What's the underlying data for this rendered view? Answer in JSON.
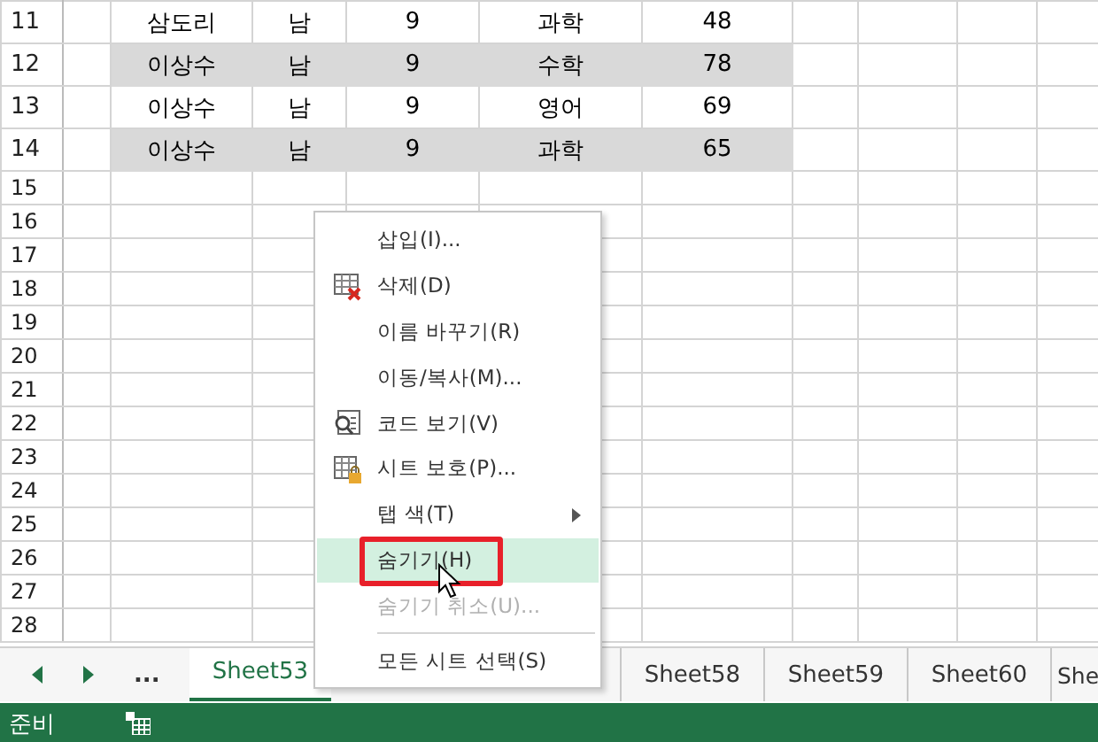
{
  "sheet": {
    "rows": [
      {
        "number": "11",
        "highlighted": false,
        "cells": [
          "삼도리",
          "남",
          "9",
          "과학",
          "48"
        ]
      },
      {
        "number": "12",
        "highlighted": true,
        "cells": [
          "이상수",
          "남",
          "9",
          "수학",
          "78"
        ]
      },
      {
        "number": "13",
        "highlighted": false,
        "cells": [
          "이상수",
          "남",
          "9",
          "영어",
          "69"
        ]
      },
      {
        "number": "14",
        "highlighted": true,
        "cells": [
          "이상수",
          "남",
          "9",
          "과학",
          "65"
        ]
      },
      {
        "number": "15",
        "highlighted": false,
        "cells": []
      },
      {
        "number": "16",
        "highlighted": false,
        "cells": []
      },
      {
        "number": "17",
        "highlighted": false,
        "cells": []
      },
      {
        "number": "18",
        "highlighted": false,
        "cells": []
      },
      {
        "number": "19",
        "highlighted": false,
        "cells": []
      },
      {
        "number": "20",
        "highlighted": false,
        "cells": []
      },
      {
        "number": "21",
        "highlighted": false,
        "cells": []
      },
      {
        "number": "22",
        "highlighted": false,
        "cells": []
      },
      {
        "number": "23",
        "highlighted": false,
        "cells": []
      },
      {
        "number": "24",
        "highlighted": false,
        "cells": []
      },
      {
        "number": "25",
        "highlighted": false,
        "cells": []
      },
      {
        "number": "26",
        "highlighted": false,
        "cells": []
      },
      {
        "number": "27",
        "highlighted": false,
        "cells": []
      },
      {
        "number": "28",
        "highlighted": false,
        "cells": []
      }
    ]
  },
  "context_menu": {
    "items": [
      {
        "label": "삽입(I)...",
        "kind": "plain",
        "disabled": false,
        "selected": false,
        "submenu": false,
        "outlined": false,
        "separator_before": false
      },
      {
        "label": "삭제(D)",
        "kind": "delete",
        "disabled": false,
        "selected": false,
        "submenu": false,
        "outlined": false,
        "separator_before": false
      },
      {
        "label": "이름 바꾸기(R)",
        "kind": "plain",
        "disabled": false,
        "selected": false,
        "submenu": false,
        "outlined": false,
        "separator_before": false
      },
      {
        "label": "이동/복사(M)...",
        "kind": "plain",
        "disabled": false,
        "selected": false,
        "submenu": false,
        "outlined": false,
        "separator_before": false
      },
      {
        "label": "코드 보기(V)",
        "kind": "code",
        "disabled": false,
        "selected": false,
        "submenu": false,
        "outlined": false,
        "separator_before": false
      },
      {
        "label": "시트 보호(P)...",
        "kind": "protect",
        "disabled": false,
        "selected": false,
        "submenu": false,
        "outlined": false,
        "separator_before": false
      },
      {
        "label": "탭 색(T)",
        "kind": "plain",
        "disabled": false,
        "selected": false,
        "submenu": true,
        "outlined": false,
        "separator_before": false
      },
      {
        "label": "숨기기(H)",
        "kind": "plain",
        "disabled": false,
        "selected": true,
        "submenu": false,
        "outlined": true,
        "separator_before": false
      },
      {
        "label": "숨기기 취소(U)...",
        "kind": "plain",
        "disabled": true,
        "selected": false,
        "submenu": false,
        "outlined": false,
        "separator_before": false
      },
      {
        "label": "모든 시트 선택(S)",
        "kind": "plain",
        "disabled": false,
        "selected": false,
        "submenu": false,
        "outlined": false,
        "separator_before": true
      }
    ]
  },
  "sheet_tabs": {
    "more": "...",
    "tabs": [
      {
        "label": "Sheet53",
        "selected": true
      },
      {
        "label": "Sheet58",
        "selected": false
      },
      {
        "label": "Sheet59",
        "selected": false
      },
      {
        "label": "Sheet60",
        "selected": false
      },
      {
        "label": "She",
        "selected": false
      }
    ]
  },
  "status_bar": {
    "text": "준비"
  }
}
